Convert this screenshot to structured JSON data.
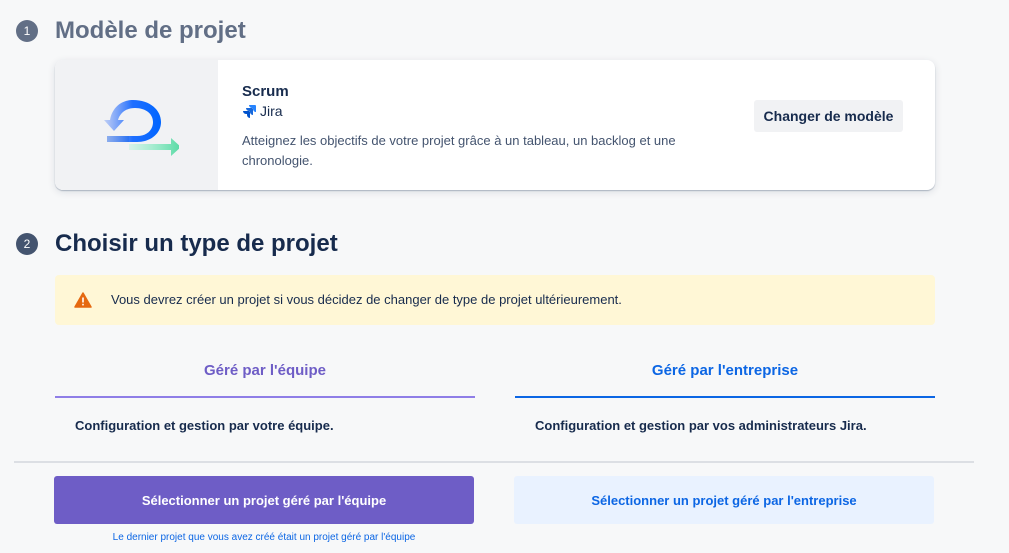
{
  "step1": {
    "number": "1",
    "title": "Modèle de projet",
    "template": {
      "name": "Scrum",
      "product": "Jira",
      "description": "Atteignez les objectifs de votre projet grâce à un tableau, un backlog et une chronologie.",
      "change_button": "Changer de modèle",
      "icon": "scrum-cycle-icon"
    }
  },
  "step2": {
    "number": "2",
    "title": "Choisir un type de projet",
    "warning": "Vous devrez créer un projet si vous décidez de changer de type de projet ultérieurement.",
    "tabs": {
      "team": "Géré par l'équipe",
      "company": "Géré par l'entreprise"
    },
    "team_heading": "Configuration et gestion par votre équipe.",
    "company_heading": "Configuration et gestion par vos administrateurs Jira."
  },
  "footer": {
    "select_team": "Sélectionner un projet géré par l'équipe",
    "select_company": "Sélectionner un projet géré par l'entreprise",
    "last_project_note": "Le dernier projet que vous avez créé était un projet géré par l'équipe"
  },
  "colors": {
    "team_accent": "#6e5dc6",
    "company_accent": "#0c66e4",
    "warning_bg": "#fff7d6"
  }
}
